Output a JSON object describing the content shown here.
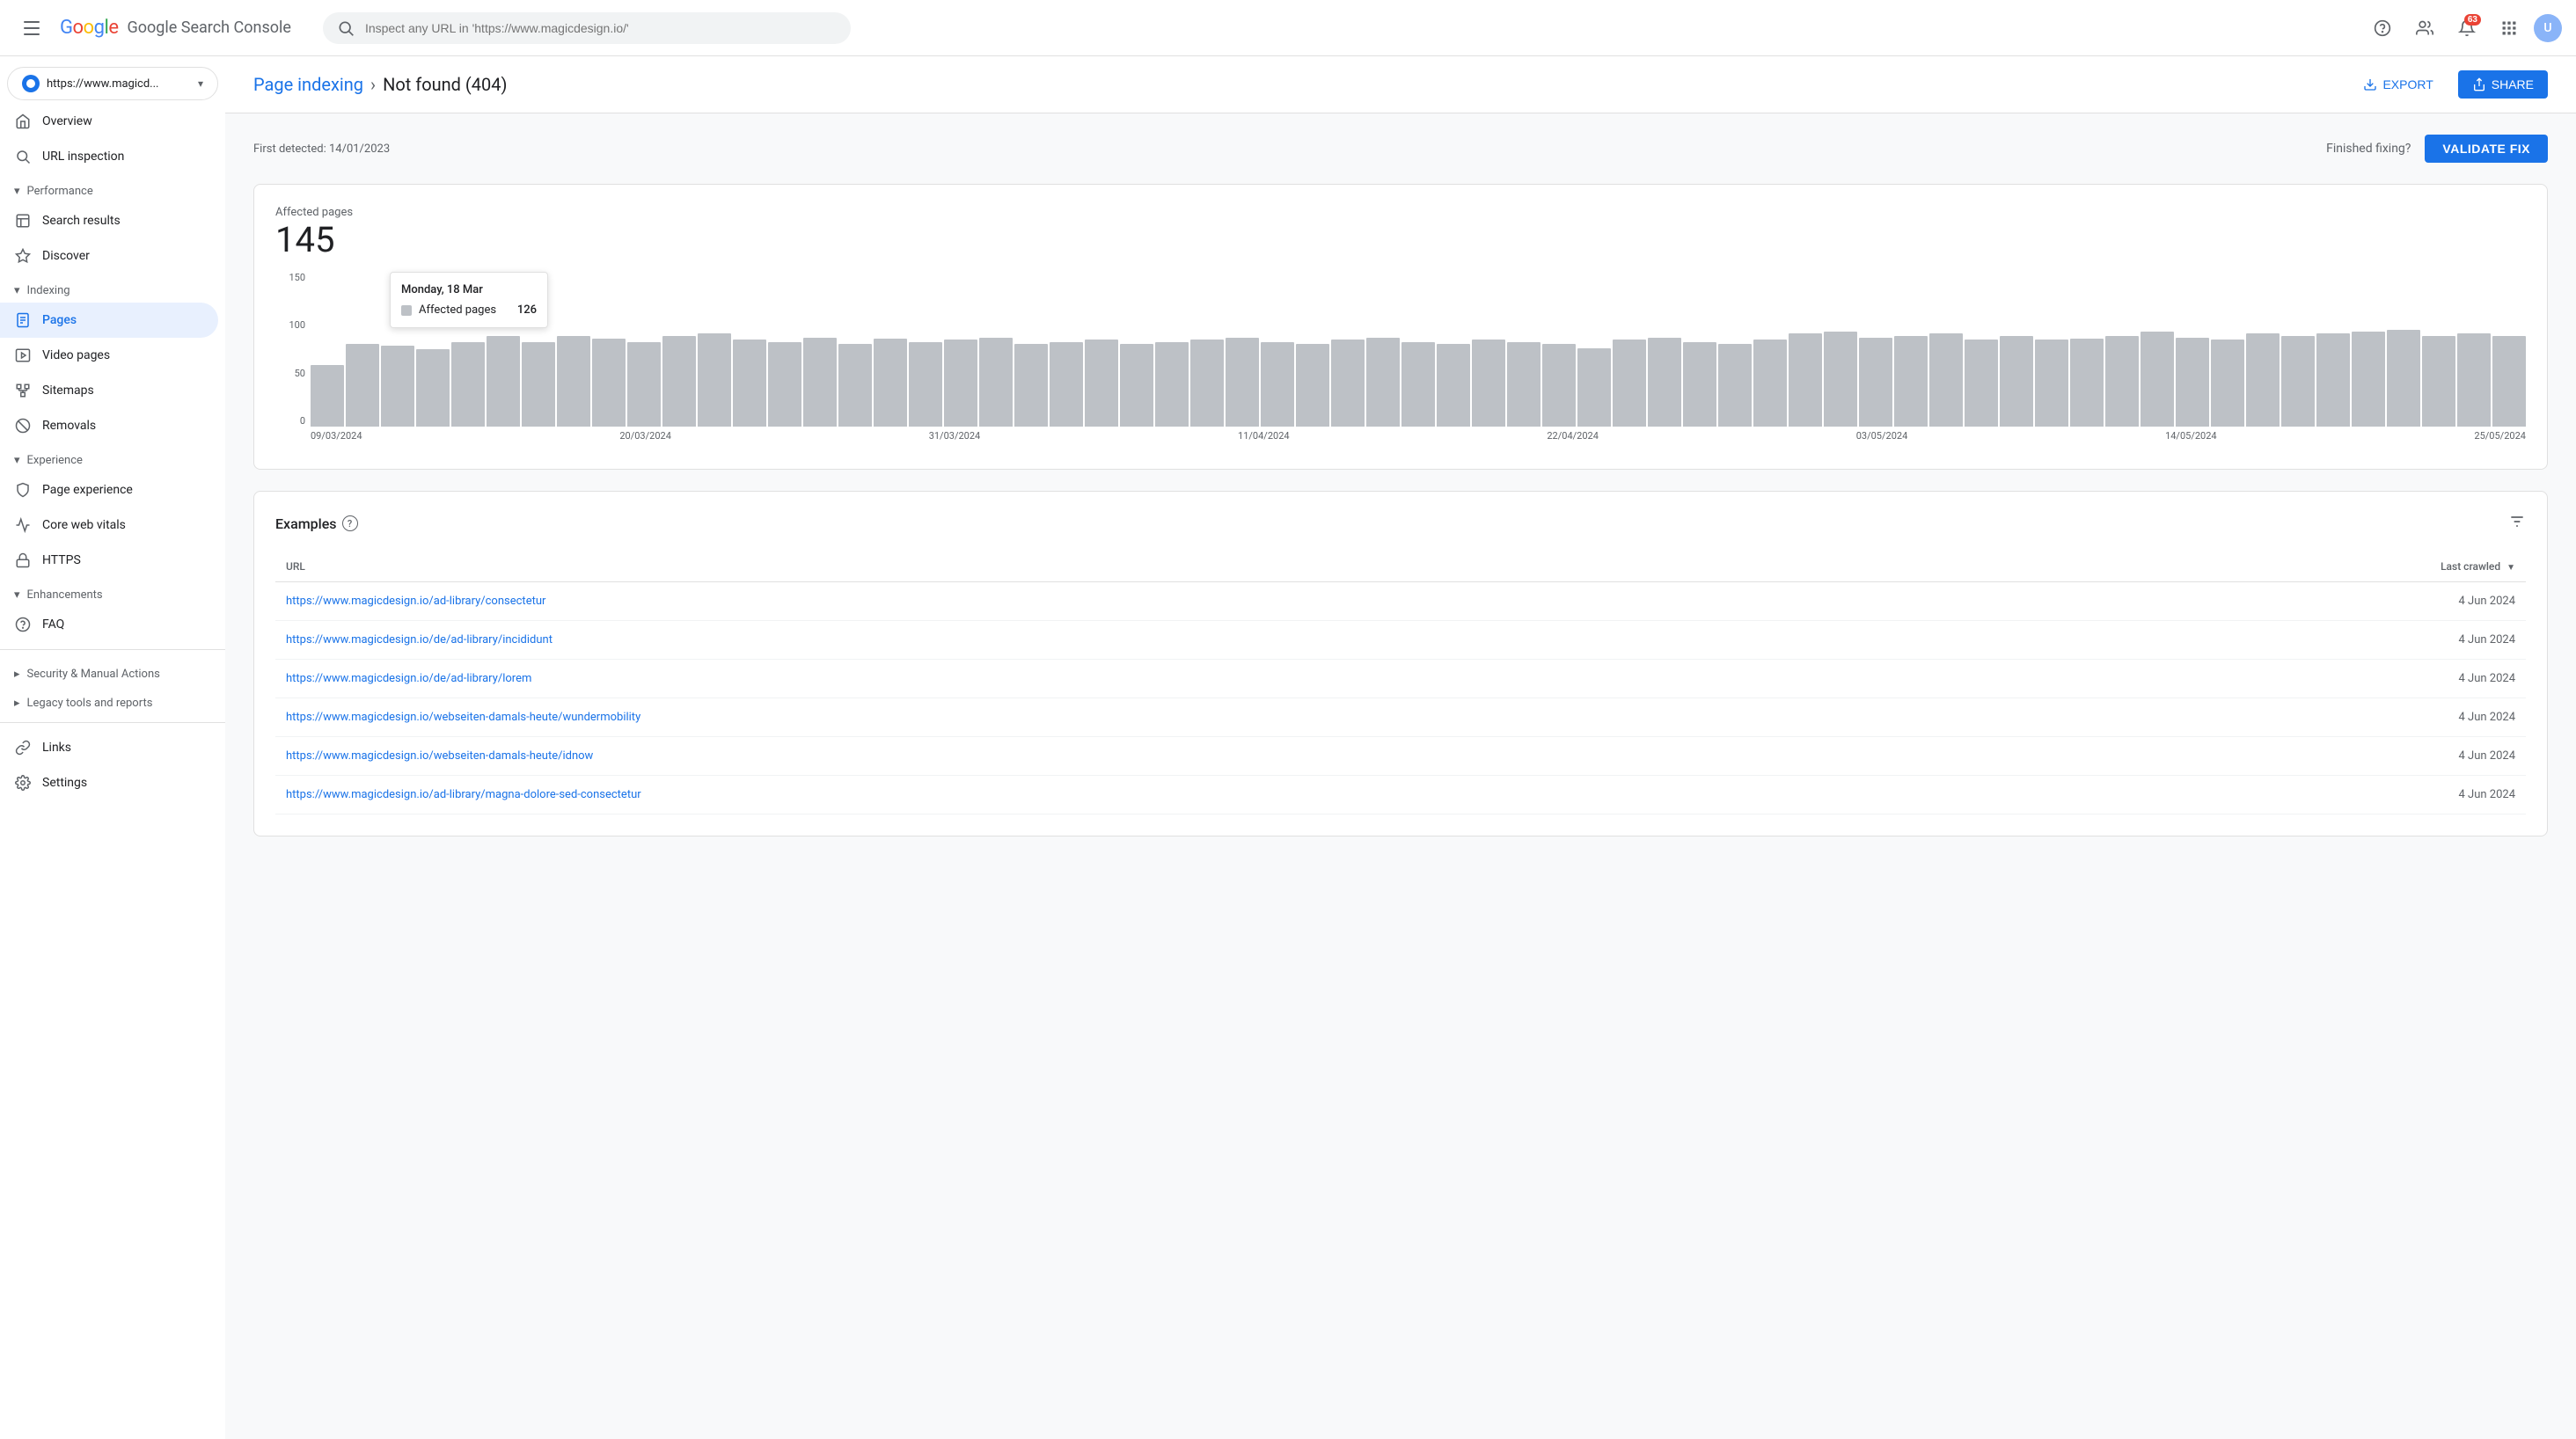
{
  "app": {
    "name": "Google Search Console"
  },
  "topbar": {
    "search_placeholder": "Inspect any URL in 'https://www.magicdesign.io/'",
    "notification_count": "63",
    "avatar_initials": "U"
  },
  "sidebar": {
    "property_url": "https://www.magicd...",
    "items": [
      {
        "id": "overview",
        "label": "Overview",
        "icon": "home"
      },
      {
        "id": "url-inspection",
        "label": "URL inspection",
        "icon": "search"
      }
    ],
    "sections": [
      {
        "id": "performance",
        "label": "Performance",
        "children": [
          {
            "id": "search-results",
            "label": "Search results",
            "icon": "chart"
          },
          {
            "id": "discover",
            "label": "Discover",
            "icon": "star"
          }
        ]
      },
      {
        "id": "indexing",
        "label": "Indexing",
        "children": [
          {
            "id": "pages",
            "label": "Pages",
            "icon": "doc",
            "active": true
          },
          {
            "id": "video-pages",
            "label": "Video pages",
            "icon": "video"
          },
          {
            "id": "sitemaps",
            "label": "Sitemaps",
            "icon": "sitemap"
          },
          {
            "id": "removals",
            "label": "Removals",
            "icon": "block"
          }
        ]
      },
      {
        "id": "experience",
        "label": "Experience",
        "children": [
          {
            "id": "page-experience",
            "label": "Page experience",
            "icon": "shield"
          },
          {
            "id": "core-web-vitals",
            "label": "Core web vitals",
            "icon": "vitals"
          },
          {
            "id": "https",
            "label": "HTTPS",
            "icon": "lock"
          }
        ]
      },
      {
        "id": "enhancements",
        "label": "Enhancements",
        "children": [
          {
            "id": "faq",
            "label": "FAQ",
            "icon": "faq"
          }
        ]
      }
    ],
    "bottom_sections": [
      {
        "id": "security",
        "label": "Security & Manual Actions"
      },
      {
        "id": "legacy",
        "label": "Legacy tools and reports"
      },
      {
        "id": "links",
        "label": "Links",
        "icon": "link"
      },
      {
        "id": "settings",
        "label": "Settings",
        "icon": "settings"
      }
    ]
  },
  "page": {
    "breadcrumb_parent": "Page indexing",
    "breadcrumb_current": "Not found (404)",
    "export_label": "EXPORT",
    "share_label": "SHARE",
    "first_detected_label": "First detected: 14/01/2023",
    "finished_fixing_label": "Finished fixing?",
    "validate_fix_label": "VALIDATE FIX"
  },
  "chart": {
    "affected_pages_label": "Affected pages",
    "affected_count": "145",
    "tooltip": {
      "date": "Monday, 18 Mar",
      "row_label": "Affected pages",
      "row_value": "126"
    },
    "y_labels": [
      "150",
      "100",
      "50",
      "0"
    ],
    "x_labels": [
      "09/03/2024",
      "20/03/2024",
      "31/03/2024",
      "11/04/2024",
      "22/04/2024",
      "03/05/2024",
      "14/05/2024",
      "25/05/2024"
    ],
    "bars": [
      60,
      80,
      78,
      75,
      82,
      88,
      82,
      88,
      85,
      82,
      88,
      90,
      84,
      82,
      86,
      80,
      85,
      82,
      84,
      86,
      80,
      82,
      84,
      80,
      82,
      84,
      86,
      82,
      80,
      84,
      86,
      82,
      80,
      84,
      82,
      80,
      76,
      84,
      86,
      82,
      80,
      84,
      90,
      92,
      86,
      88,
      90,
      84,
      88,
      84,
      85,
      88,
      92,
      86,
      84,
      90,
      88,
      90,
      92,
      94,
      88,
      90,
      88
    ]
  },
  "examples": {
    "title": "Examples",
    "url_col": "URL",
    "last_crawled_col": "Last crawled",
    "rows": [
      {
        "url": "https://www.magicdesign.io/ad-library/consectetur",
        "last_crawled": "4 Jun 2024"
      },
      {
        "url": "https://www.magicdesign.io/de/ad-library/incididunt",
        "last_crawled": "4 Jun 2024"
      },
      {
        "url": "https://www.magicdesign.io/de/ad-library/lorem",
        "last_crawled": "4 Jun 2024"
      },
      {
        "url": "https://www.magicdesign.io/webseiten-damals-heute/wundermobility",
        "last_crawled": "4 Jun 2024"
      },
      {
        "url": "https://www.magicdesign.io/webseiten-damals-heute/idnow",
        "last_crawled": "4 Jun 2024"
      },
      {
        "url": "https://www.magicdesign.io/ad-library/magna-dolore-sed-consectetur",
        "last_crawled": "4 Jun 2024"
      }
    ]
  }
}
